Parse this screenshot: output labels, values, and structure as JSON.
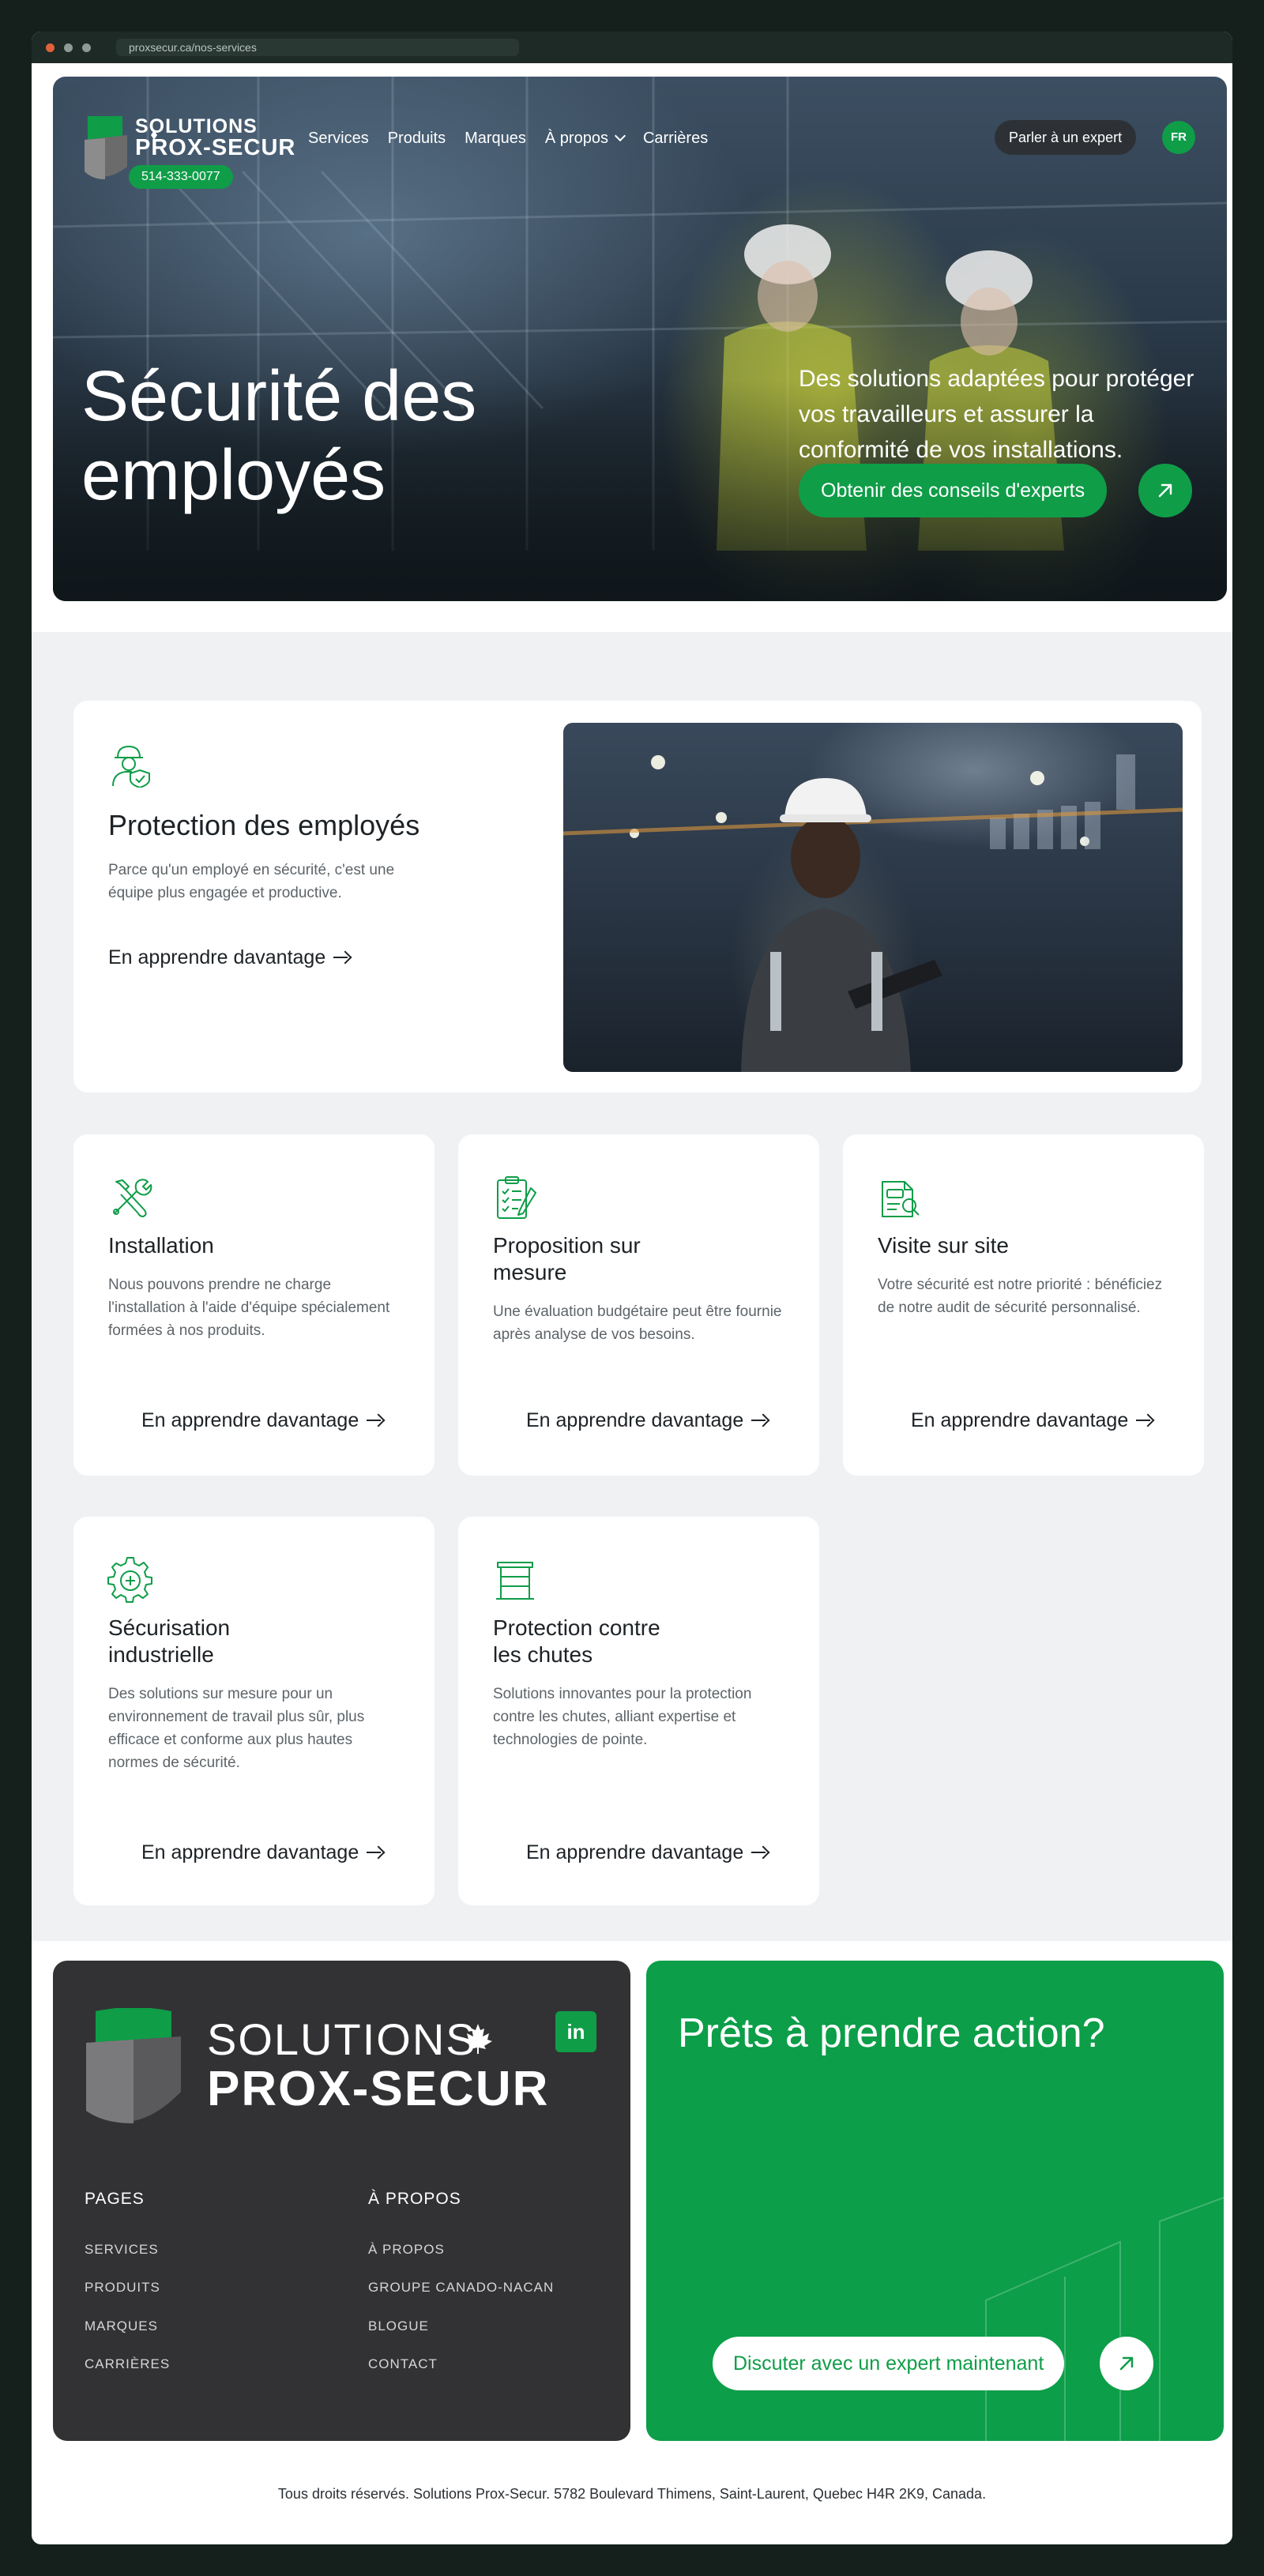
{
  "browser": {
    "url": "proxsecur.ca/nos-services"
  },
  "header": {
    "logo": {
      "line1": "SOLUTIONS",
      "line2": "PROX-SECUR"
    },
    "phone": "514-333-0077",
    "nav": [
      {
        "label": "Services"
      },
      {
        "label": "Produits"
      },
      {
        "label": "Marques"
      },
      {
        "label": "À propos"
      },
      {
        "label": "Carrières"
      }
    ],
    "expert_button": "Parler à un expert",
    "language": "FR"
  },
  "hero": {
    "title": "Sécurité des employés",
    "description": "Des solutions adaptées pour protéger vos travailleurs et assurer la conformité de vos installations.",
    "cta": "Obtenir des conseils d'experts"
  },
  "services": {
    "featured": {
      "title": "Protection des employés",
      "description": "Parce qu'un employé en sécurité, c'est une équipe plus engagée et productive.",
      "link": "En apprendre davantage",
      "icon": "worker-shield-icon"
    },
    "cards": [
      {
        "title": "Installation",
        "description": "Nous pouvons prendre ne charge l'installation à l'aide d'équipe spécialement formées à nos produits.",
        "link": "En apprendre davantage",
        "icon": "tools-icon"
      },
      {
        "title": "Proposition sur mesure",
        "description": "Une évaluation budgétaire peut être fournie après analyse de vos besoins.",
        "link": "En apprendre davantage",
        "icon": "clipboard-checklist-icon"
      },
      {
        "title": "Visite sur site",
        "description": "Votre sécurité est notre priorité : bénéficiez de notre audit de sécurité personnalisé.",
        "link": "En apprendre davantage",
        "icon": "audit-document-icon"
      },
      {
        "title": "Sécurisation industrielle",
        "description": "Des solutions sur mesure pour un environnement de travail plus sûr, plus efficace et conforme aux plus hautes normes de sécurité.",
        "link": "En apprendre davantage",
        "icon": "gear-plus-icon"
      },
      {
        "title": "Protection contre les chutes",
        "description": "Solutions innovantes pour la protection contre les chutes, alliant expertise et technologies de pointe.",
        "link": "En apprendre davantage",
        "icon": "guardrail-icon"
      }
    ]
  },
  "footer": {
    "logo": {
      "line1": "SOLUTIONS",
      "line2": "PROX-SECUR"
    },
    "linkedin": "in",
    "pages": {
      "heading": "PAGES",
      "links": [
        "SERVICES",
        "PRODUITS",
        "MARQUES",
        "CARRIÈRES"
      ]
    },
    "about": {
      "heading": "À PROPOS",
      "links": [
        "À PROPOS",
        "GROUPE CANADO-NACAN",
        "BLOGUE",
        "CONTACT"
      ]
    },
    "cta": {
      "title": "Prêts à prendre action?",
      "button": "Discuter avec un expert maintenant"
    },
    "copyright": "Tous droits réservés. Solutions Prox-Secur. 5782 Boulevard Thimens, Saint-Laurent, Quebec H4R 2K9, Canada."
  },
  "colors": {
    "brand_green": "#0f9d48",
    "dark": "#323234",
    "section_bg": "#f0f1f3"
  }
}
